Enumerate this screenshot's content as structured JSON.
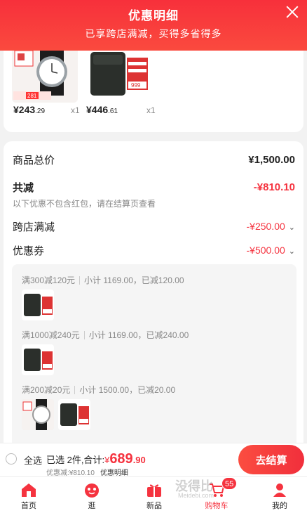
{
  "header": {
    "title": "优惠明细",
    "subtitle": "已享跨店满减，买得多省得多"
  },
  "products": [
    {
      "price_int": "¥243",
      "price_dec": ".29",
      "qty": "x1",
      "thumb_badge": "281"
    },
    {
      "price_int": "¥446",
      "price_dec": ".61",
      "qty": "x1",
      "thumb_badge": "999"
    }
  ],
  "summary": {
    "total_label": "商品总价",
    "total_value": "¥1,500.00",
    "discount_label": "共减",
    "discount_value": "-¥810.10",
    "note": "以下优惠不包含红包，请在结算页查看",
    "cross_store_label": "跨店满减",
    "cross_store_value": "-¥250.00",
    "coupon_label": "优惠券",
    "coupon_value": "-¥500.00"
  },
  "groups": [
    {
      "rule": "满300减120元",
      "subtotal": "小计 1169.00，已减120.00"
    },
    {
      "rule": "满1000减240元",
      "subtotal": "小计 1169.00，已减240.00"
    },
    {
      "rule": "满200减20元",
      "subtotal": "小计 1500.00，已减20.00"
    }
  ],
  "checkout": {
    "select_all": "全选",
    "selected": "已选 2件,合计:",
    "currency": "¥",
    "amount_int": "689",
    "amount_dec": ".90",
    "saved": "优惠减:¥810.10",
    "detail_link": "优惠明细",
    "button": "去结算"
  },
  "tabbar": {
    "items": [
      {
        "label": "首页",
        "icon": "home-icon"
      },
      {
        "label": "逛",
        "icon": "stroll-icon"
      },
      {
        "label": "新品",
        "icon": "gift-icon"
      },
      {
        "label": "购物车",
        "icon": "cart-icon"
      },
      {
        "label": "我的",
        "icon": "profile-icon"
      }
    ],
    "cart_badge": "55",
    "watermark": "没得比",
    "watermark_small": "Meidebi.com"
  },
  "colors": {
    "accent": "#f5333f",
    "header_bg": "#f7303b"
  }
}
